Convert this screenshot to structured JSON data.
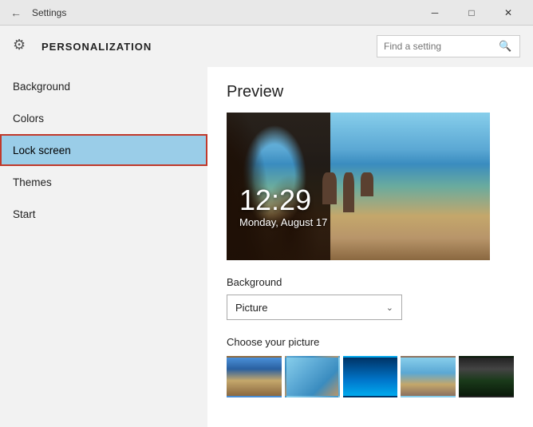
{
  "titlebar": {
    "title": "Settings",
    "minimize_label": "─",
    "maximize_label": "□",
    "close_label": "✕"
  },
  "header": {
    "icon": "⚙",
    "title": "PERSONALIZATION",
    "search_placeholder": "Find a setting"
  },
  "sidebar": {
    "items": [
      {
        "id": "background",
        "label": "Background",
        "active": false
      },
      {
        "id": "colors",
        "label": "Colors",
        "active": false
      },
      {
        "id": "lock-screen",
        "label": "Lock screen",
        "active": true
      },
      {
        "id": "themes",
        "label": "Themes",
        "active": false
      },
      {
        "id": "start",
        "label": "Start",
        "active": false
      }
    ]
  },
  "main": {
    "preview_title": "Preview",
    "preview_time": "12:29",
    "preview_date": "Monday, August 17",
    "background_label": "Background",
    "background_dropdown": "Picture",
    "choose_picture_label": "Choose your picture",
    "dropdown_arrow": "⌄"
  }
}
